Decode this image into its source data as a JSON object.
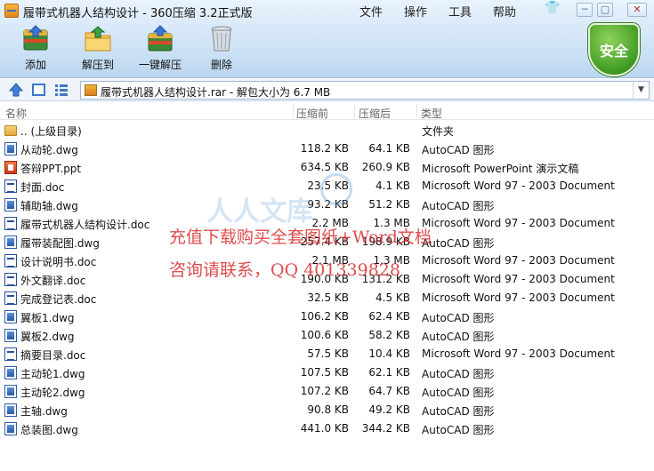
{
  "window": {
    "title": "履带式机器人结构设计 - 360压缩 3.2正式版",
    "menu": [
      "文件",
      "操作",
      "工具",
      "帮助"
    ],
    "controls": {
      "skin": "👕",
      "minimize": "─",
      "maximize": "▢",
      "close": "✕"
    }
  },
  "toolbar": {
    "add": "添加",
    "extract": "解压到",
    "oneclick": "一键解压",
    "delete": "删除",
    "security": "安全"
  },
  "address": {
    "text": "履带式机器人结构设计.rar - 解包大小为 6.7 MB"
  },
  "columns": {
    "name": "名称",
    "size": "压缩前",
    "packed": "压缩后",
    "type": "类型"
  },
  "files": [
    {
      "icon": "folder",
      "name": ".. (上级目录)",
      "size": "",
      "packed": "",
      "type": "文件夹"
    },
    {
      "icon": "dwg",
      "name": "从动轮.dwg",
      "size": "118.2 KB",
      "packed": "64.1 KB",
      "type": "AutoCAD 图形"
    },
    {
      "icon": "ppt",
      "name": "答辩PPT.ppt",
      "size": "634.5 KB",
      "packed": "260.9 KB",
      "type": "Microsoft PowerPoint 演示文稿"
    },
    {
      "icon": "doc",
      "name": "封面.doc",
      "size": "23.5 KB",
      "packed": "4.1 KB",
      "type": "Microsoft Word 97 - 2003 Document"
    },
    {
      "icon": "dwg",
      "name": "辅助轴.dwg",
      "size": "93.2 KB",
      "packed": "51.2 KB",
      "type": "AutoCAD 图形"
    },
    {
      "icon": "doc",
      "name": "履带式机器人结构设计.doc",
      "size": "2.2 MB",
      "packed": "1.3 MB",
      "type": "Microsoft Word 97 - 2003 Document"
    },
    {
      "icon": "dwg",
      "name": "履带装配图.dwg",
      "size": "257.4 KB",
      "packed": "198.9 KB",
      "type": "AutoCAD 图形"
    },
    {
      "icon": "doc",
      "name": "设计说明书.doc",
      "size": "2.1 MB",
      "packed": "1.3 MB",
      "type": "Microsoft Word 97 - 2003 Document"
    },
    {
      "icon": "doc",
      "name": "外文翻译.doc",
      "size": "190.0 KB",
      "packed": "131.2 KB",
      "type": "Microsoft Word 97 - 2003 Document"
    },
    {
      "icon": "doc",
      "name": "完成登记表.doc",
      "size": "32.5 KB",
      "packed": "4.5 KB",
      "type": "Microsoft Word 97 - 2003 Document"
    },
    {
      "icon": "dwg",
      "name": "翼板1.dwg",
      "size": "106.2 KB",
      "packed": "62.4 KB",
      "type": "AutoCAD 图形"
    },
    {
      "icon": "dwg",
      "name": "翼板2.dwg",
      "size": "100.6 KB",
      "packed": "58.2 KB",
      "type": "AutoCAD 图形"
    },
    {
      "icon": "doc",
      "name": "摘要目录.doc",
      "size": "57.5 KB",
      "packed": "10.4 KB",
      "type": "Microsoft Word 97 - 2003 Document"
    },
    {
      "icon": "dwg",
      "name": "主动轮1.dwg",
      "size": "107.5 KB",
      "packed": "62.1 KB",
      "type": "AutoCAD 图形"
    },
    {
      "icon": "dwg",
      "name": "主动轮2.dwg",
      "size": "107.2 KB",
      "packed": "64.7 KB",
      "type": "AutoCAD 图形"
    },
    {
      "icon": "dwg",
      "name": "主轴.dwg",
      "size": "90.8 KB",
      "packed": "49.2 KB",
      "type": "AutoCAD 图形"
    },
    {
      "icon": "dwg",
      "name": "总装图.dwg",
      "size": "441.0 KB",
      "packed": "344.2 KB",
      "type": "AutoCAD 图形"
    }
  ],
  "watermark": {
    "logo": "人人文库",
    "line1": "充值下载购买全套图纸+Word文档",
    "line2": "咨询请联系，QQ 401339828"
  }
}
